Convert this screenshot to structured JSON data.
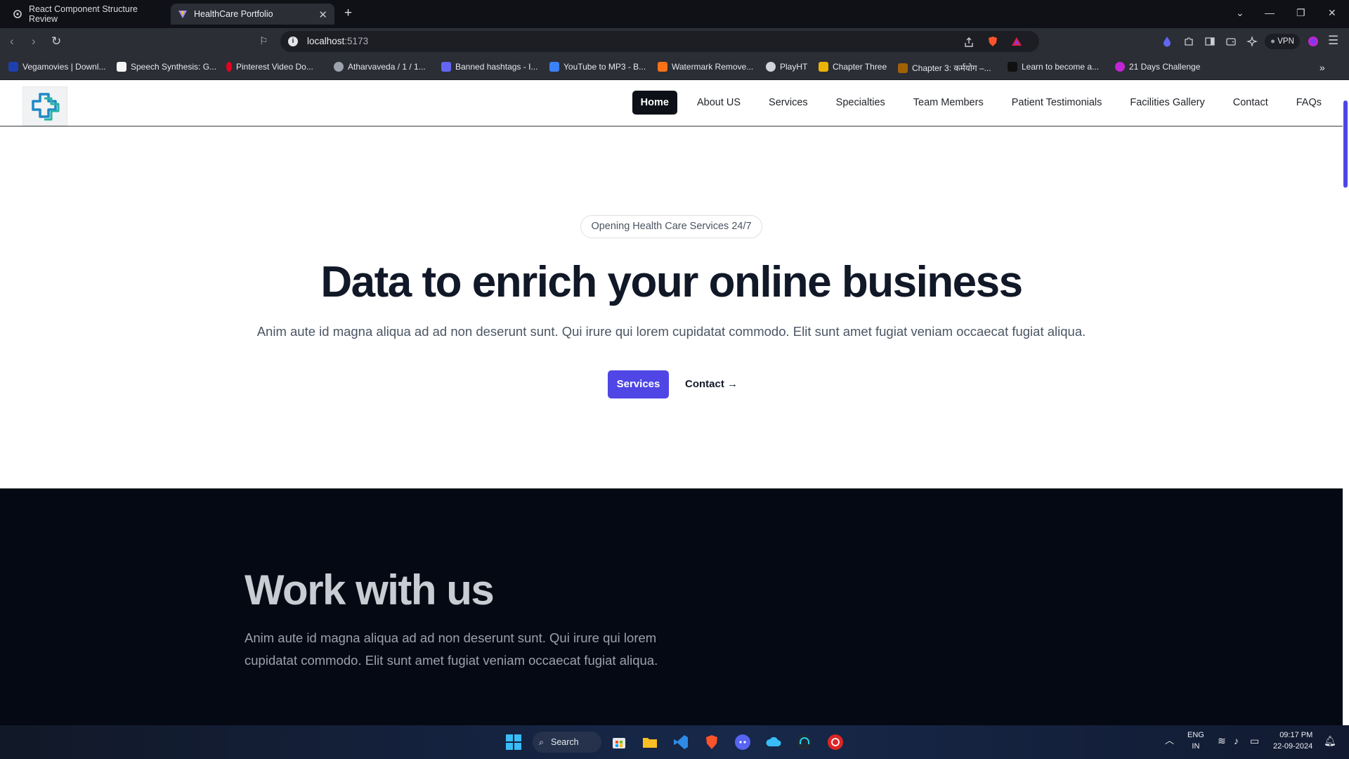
{
  "browser": {
    "tabs": [
      {
        "title": "React Component Structure Review",
        "active": false
      },
      {
        "title": "HealthCare Portfolio",
        "active": true
      }
    ],
    "url_host": "localhost",
    "url_port": ":5173",
    "vpn_label": "VPN",
    "bookmarks": [
      "Vegamovies | Downl...",
      "Speech Synthesis: G...",
      "Pinterest Video Do...",
      "Atharvaveda / 1 / 1...",
      "Banned hashtags - I...",
      "YouTube to MP3 - B...",
      "Watermark Remove...",
      "PlayHT",
      "Chapter Three",
      "Chapter 3: कर्मयोग –...",
      "Learn to become a...",
      "21 Days Challenge"
    ]
  },
  "site": {
    "nav": [
      "Home",
      "About US",
      "Services",
      "Specialties",
      "Team Members",
      "Patient Testimonials",
      "Facilities Gallery",
      "Contact",
      "FAQs"
    ],
    "hero": {
      "badge": "Opening Health Care Services 24/7",
      "title": "Data to enrich your online business",
      "subtitle": "Anim aute id magna aliqua ad ad non deserunt sunt. Qui irure qui lorem cupidatat commodo. Elit sunt amet fugiat veniam occaecat fugiat aliqua.",
      "primary_button": "Services",
      "secondary_link": "Contact →"
    },
    "work": {
      "title": "Work with us",
      "text": "Anim aute id magna aliqua ad ad non deserunt sunt. Qui irure qui lorem cupidatat commodo. Elit sunt amet fugiat veniam occaecat fugiat aliqua."
    }
  },
  "taskbar": {
    "search_label": "Search",
    "lang_top": "ENG",
    "lang_bottom": "IN",
    "time": "09:17 PM",
    "date": "22-09-2024"
  },
  "colors": {
    "accent": "#4f46e5",
    "nav_active_bg": "#0d1117",
    "dark_section_bg": "#050913"
  }
}
